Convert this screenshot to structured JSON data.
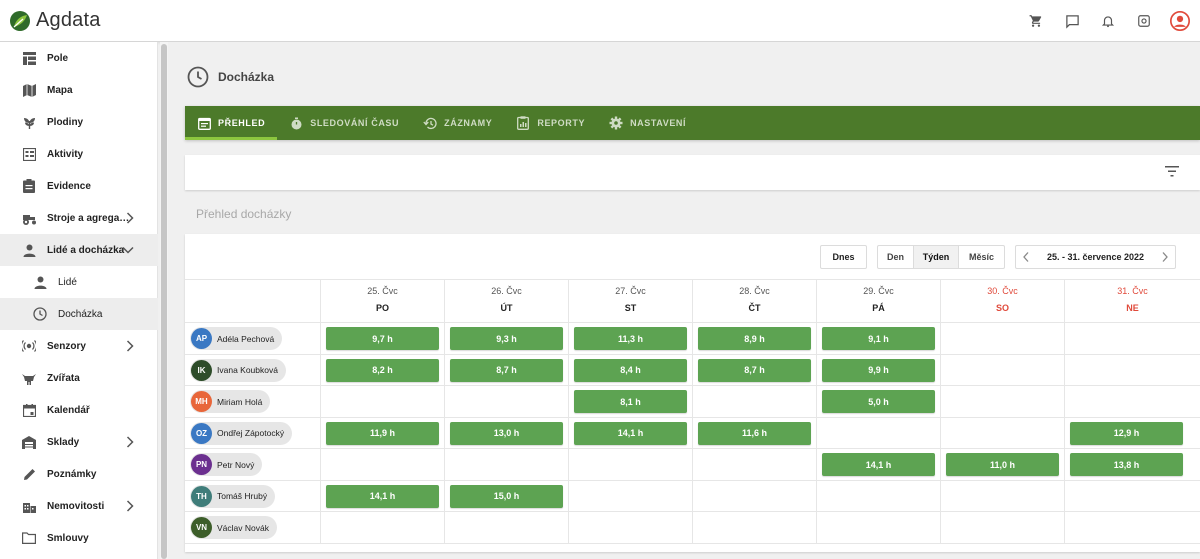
{
  "app": {
    "name": "Agdata"
  },
  "topbar": {
    "icons": [
      "cart-icon",
      "chat-icon",
      "bell-icon",
      "settings-icon",
      "user-avatar-icon"
    ]
  },
  "sidebar": {
    "items": [
      {
        "label": "Pole",
        "icon": "fields-icon"
      },
      {
        "label": "Mapa",
        "icon": "map-icon"
      },
      {
        "label": "Plodiny",
        "icon": "crops-icon"
      },
      {
        "label": "Aktivity",
        "icon": "activities-icon"
      },
      {
        "label": "Evidence",
        "icon": "evidence-icon"
      },
      {
        "label": "Stroje a agrega…",
        "icon": "tractor-icon",
        "chevron": "right"
      },
      {
        "label": "Lidé a docházka",
        "icon": "person-icon",
        "chevron": "down",
        "expanded": true
      },
      {
        "label": "Lidé",
        "icon": "person-icon",
        "sub": true
      },
      {
        "label": "Docházka",
        "icon": "clock-icon",
        "sub": true,
        "active": true
      },
      {
        "label": "Senzory",
        "icon": "sensor-icon",
        "chevron": "right"
      },
      {
        "label": "Zvířata",
        "icon": "animal-icon"
      },
      {
        "label": "Kalendář",
        "icon": "calendar-icon"
      },
      {
        "label": "Sklady",
        "icon": "warehouse-icon",
        "chevron": "right"
      },
      {
        "label": "Poznámky",
        "icon": "pencil-icon"
      },
      {
        "label": "Nemovitosti",
        "icon": "building-icon",
        "chevron": "right"
      },
      {
        "label": "Smlouvy",
        "icon": "folder-icon"
      }
    ]
  },
  "page": {
    "title": "Docházka"
  },
  "tabs": [
    {
      "label": "PŘEHLED",
      "icon": "overview-icon",
      "active": true
    },
    {
      "label": "SLEDOVÁNÍ ČASU",
      "icon": "stopwatch-icon"
    },
    {
      "label": "ZÁZNAMY",
      "icon": "history-icon"
    },
    {
      "label": "REPORTY",
      "icon": "report-icon"
    },
    {
      "label": "NASTAVENÍ",
      "icon": "gear-icon"
    }
  ],
  "section": {
    "title": "Přehled docházky"
  },
  "controls": {
    "today": "Dnes",
    "views": [
      "Den",
      "Týden",
      "Měsíc"
    ],
    "active_view": "Týden",
    "date_range": "25. - 31. července 2022"
  },
  "days": [
    {
      "date": "25. Čvc",
      "name": "PO",
      "weekend": false
    },
    {
      "date": "26. Čvc",
      "name": "ÚT",
      "weekend": false
    },
    {
      "date": "27. Čvc",
      "name": "ST",
      "weekend": false
    },
    {
      "date": "28. Čvc",
      "name": "ČT",
      "weekend": false
    },
    {
      "date": "29. Čvc",
      "name": "PÁ",
      "weekend": false
    },
    {
      "date": "30. Čvc",
      "name": "SO",
      "weekend": true
    },
    {
      "date": "31. Čvc",
      "name": "NE",
      "weekend": true
    }
  ],
  "people": [
    {
      "initials": "AP",
      "name": "Adéla Pechová",
      "color": "#3a78c3",
      "hours": [
        "9,7 h",
        "9,3 h",
        "11,3 h",
        "8,9 h",
        "9,1 h",
        "",
        ""
      ]
    },
    {
      "initials": "IK",
      "name": "Ivana Koubková",
      "color": "#2e4d2a",
      "hours": [
        "8,2 h",
        "8,7 h",
        "8,4 h",
        "8,7 h",
        "9,9 h",
        "",
        ""
      ]
    },
    {
      "initials": "MH",
      "name": "Miriam Holá",
      "color": "#e8663a",
      "hours": [
        "",
        "",
        "8,1 h",
        "",
        "5,0 h",
        "",
        ""
      ]
    },
    {
      "initials": "OZ",
      "name": "Ondřej Zápotocký",
      "color": "#3a78c3",
      "hours": [
        "11,9 h",
        "13,0 h",
        "14,1 h",
        "11,6 h",
        "",
        "",
        "12,9 h"
      ]
    },
    {
      "initials": "PN",
      "name": "Petr Nový",
      "color": "#6b2f8f",
      "hours": [
        "",
        "",
        "",
        "",
        "14,1 h",
        "11,0 h",
        "13,8 h"
      ]
    },
    {
      "initials": "TH",
      "name": "Tomáš Hrubý",
      "color": "#3f7d7a",
      "hours": [
        "14,1 h",
        "15,0 h",
        "",
        "",
        "",
        "",
        ""
      ]
    },
    {
      "initials": "VN",
      "name": "Václav Novák",
      "color": "#3d5e2a",
      "hours": [
        "",
        "",
        "",
        "",
        "",
        "",
        ""
      ]
    }
  ]
}
